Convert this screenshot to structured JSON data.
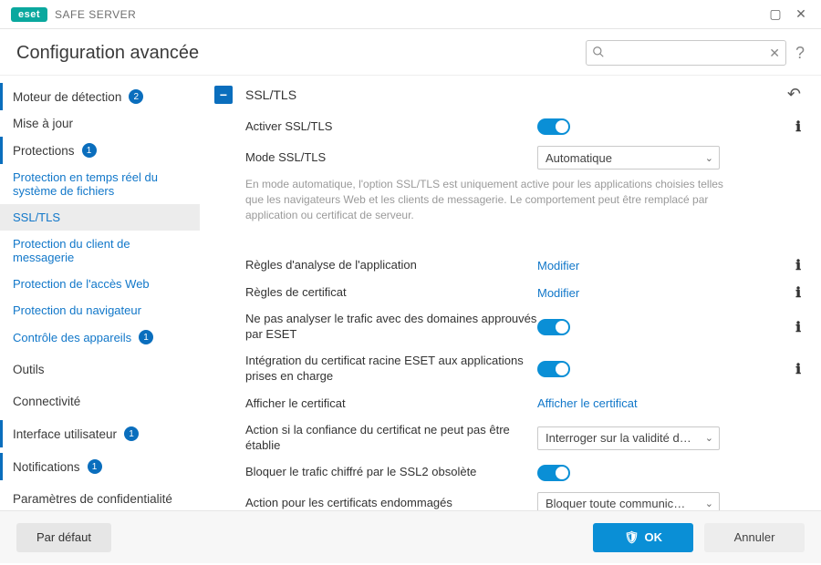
{
  "brand": {
    "badge": "eset",
    "product": "SAFE SERVER"
  },
  "window": {
    "maximize_icon": "▢",
    "close_icon": "✕"
  },
  "header": {
    "title": "Configuration avancée",
    "search_placeholder": "",
    "help": "?"
  },
  "sidebar": [
    {
      "label": "Moteur de détection",
      "badge": "2",
      "accent": true,
      "sub": false
    },
    {
      "label": "Mise à jour",
      "accent": false,
      "sub": false
    },
    {
      "label": "Protections",
      "badge": "1",
      "accent": true,
      "sub": false
    },
    {
      "label": "Protection en temps réel du système de fichiers",
      "sub": true
    },
    {
      "label": "SSL/TLS",
      "sub": true,
      "active": true
    },
    {
      "label": "Protection du client de messagerie",
      "sub": true
    },
    {
      "label": "Protection de l'accès Web",
      "sub": true
    },
    {
      "label": "Protection du navigateur",
      "sub": true
    },
    {
      "label": "Contrôle des appareils",
      "badge": "1",
      "sub": true
    },
    {
      "label": "Outils",
      "accent": false,
      "sub": false
    },
    {
      "label": "Connectivité",
      "accent": false,
      "sub": false
    },
    {
      "label": "Interface utilisateur",
      "badge": "1",
      "accent": true,
      "sub": false
    },
    {
      "label": "Notifications",
      "badge": "1",
      "accent": true,
      "sub": false
    },
    {
      "label": "Paramètres de confidentialité",
      "accent": false,
      "sub": false
    }
  ],
  "section": {
    "title": "SSL/TLS",
    "collapse_glyph": "−",
    "revert_glyph": "↶",
    "rows": {
      "enable": {
        "label": "Activer SSL/TLS",
        "toggle": true
      },
      "mode": {
        "label": "Mode SSL/TLS",
        "value": "Automatique"
      },
      "mode_desc": "En mode automatique, l'option SSL/TLS est uniquement active pour les applications choisies telles que les navigateurs Web et les clients de messagerie. Le comportement peut être remplacé par application ou certificat de serveur.",
      "app_rules": {
        "label": "Règles d'analyse de l'application",
        "link": "Modifier"
      },
      "cert_rules": {
        "label": "Règles de certificat",
        "link": "Modifier"
      },
      "exclude_trusted": {
        "label": "Ne pas analyser le trafic avec des domaines approuvés par ESET",
        "toggle": true
      },
      "root_cert": {
        "label": "Intégration du certificat racine ESET aux applications prises en charge",
        "toggle": true
      },
      "show_cert": {
        "label": "Afficher le certificat",
        "link": "Afficher le certificat"
      },
      "untrusted_action": {
        "label": "Action si la confiance du certificat ne peut pas être établie",
        "value": "Interroger sur la validité du …"
      },
      "block_ssl2": {
        "label": "Bloquer le trafic chiffré par le SSL2 obsolète",
        "toggle": true
      },
      "damaged_action": {
        "label": "Action pour les certificats endommagés",
        "value": "Bloquer toute communicati…"
      }
    }
  },
  "footer": {
    "default": "Par défaut",
    "ok": "OK",
    "cancel": "Annuler"
  },
  "glyphs": {
    "info": "ℹ",
    "chevron": "⌄",
    "search": "🔍",
    "clear": "✕",
    "shield": "🛡"
  }
}
